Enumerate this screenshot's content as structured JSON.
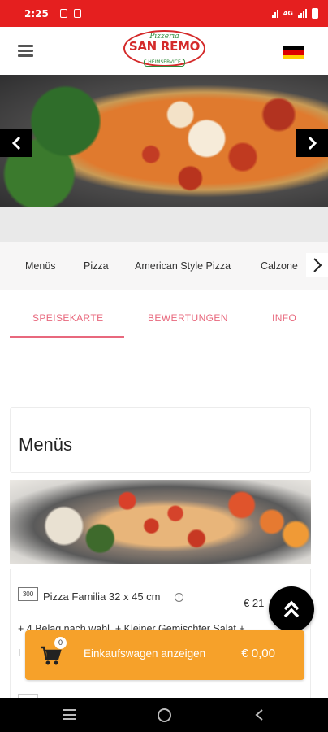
{
  "status_bar": {
    "time": "2:25",
    "network": "4G",
    "icons": [
      "notification-icon",
      "notification-icon",
      "vowifi-icon",
      "signal-icon",
      "battery-icon"
    ]
  },
  "header": {
    "logo": {
      "line1": "Pizzeria",
      "line2": "SAN REMO",
      "line3": "HEIMSERVICE"
    },
    "menu_icon": "hamburger-icon",
    "language_flag": "germany-flag-icon",
    "flag_colors": [
      "#000000",
      "#dd0000",
      "#ffce00"
    ]
  },
  "carousel": {
    "prev_icon": "chevron-left-icon",
    "next_icon": "chevron-right-icon"
  },
  "categories": {
    "items": [
      "Menüs",
      "Pizza",
      "American Style Pizza",
      "Calzone"
    ],
    "more_icon": "chevron-right-icon"
  },
  "tabs": {
    "items": [
      "SPEISEKARTE",
      "BEWERTUNGEN",
      "INFO"
    ],
    "active": "SPEISEKARTE",
    "accent": "#e8687d"
  },
  "section": {
    "title": "Menüs"
  },
  "item": {
    "number": "300",
    "name": "Pizza Familia 32 x 45 cm",
    "price": "€ 21",
    "description": "+ 4 Belag nach wahl, + Kleiner Gemischter Salat +",
    "description_line2": "L"
  },
  "cart": {
    "count": "0",
    "label": "Einkaufswagen anzeigen",
    "total": "€ 0,00",
    "color": "#f6a12a"
  },
  "colors": {
    "status_bar": "#e51f1f",
    "brand_red": "#d42a2a",
    "brand_green": "#2e8b3a"
  }
}
